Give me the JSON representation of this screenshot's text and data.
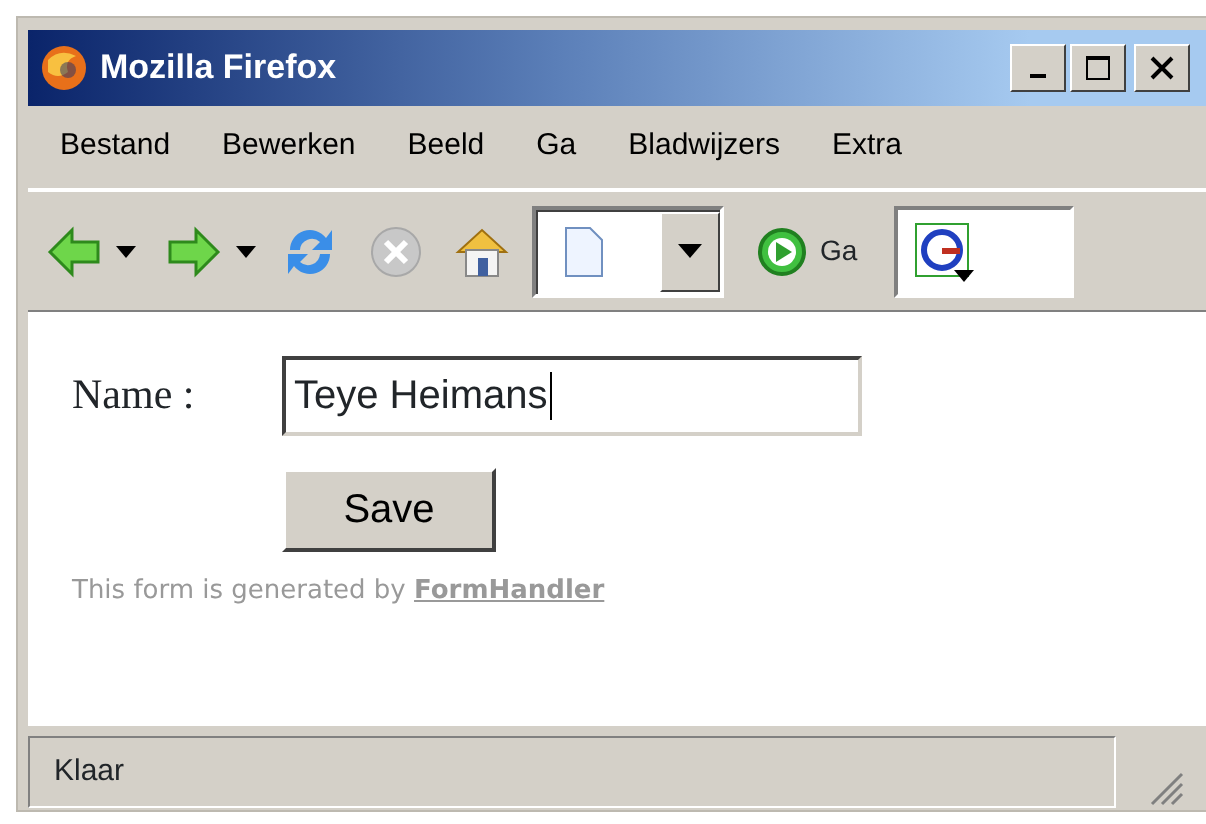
{
  "window": {
    "title": "Mozilla Firefox"
  },
  "menu": [
    {
      "label": "Bestand"
    },
    {
      "label": "Bewerken"
    },
    {
      "label": "Beeld"
    },
    {
      "label": "Ga"
    },
    {
      "label": "Bladwijzers"
    },
    {
      "label": "Extra"
    }
  ],
  "toolbar": {
    "stop": {
      "disabled": true
    },
    "go_label": "Ga"
  },
  "form": {
    "fields": [
      {
        "label": "Name :",
        "value": "Teye Heimans",
        "focused": true
      }
    ],
    "submit": "Save",
    "footer_text": "This form is generated by",
    "footer_link": "FormHandler"
  },
  "status_bar": {
    "text": "Klaar"
  }
}
